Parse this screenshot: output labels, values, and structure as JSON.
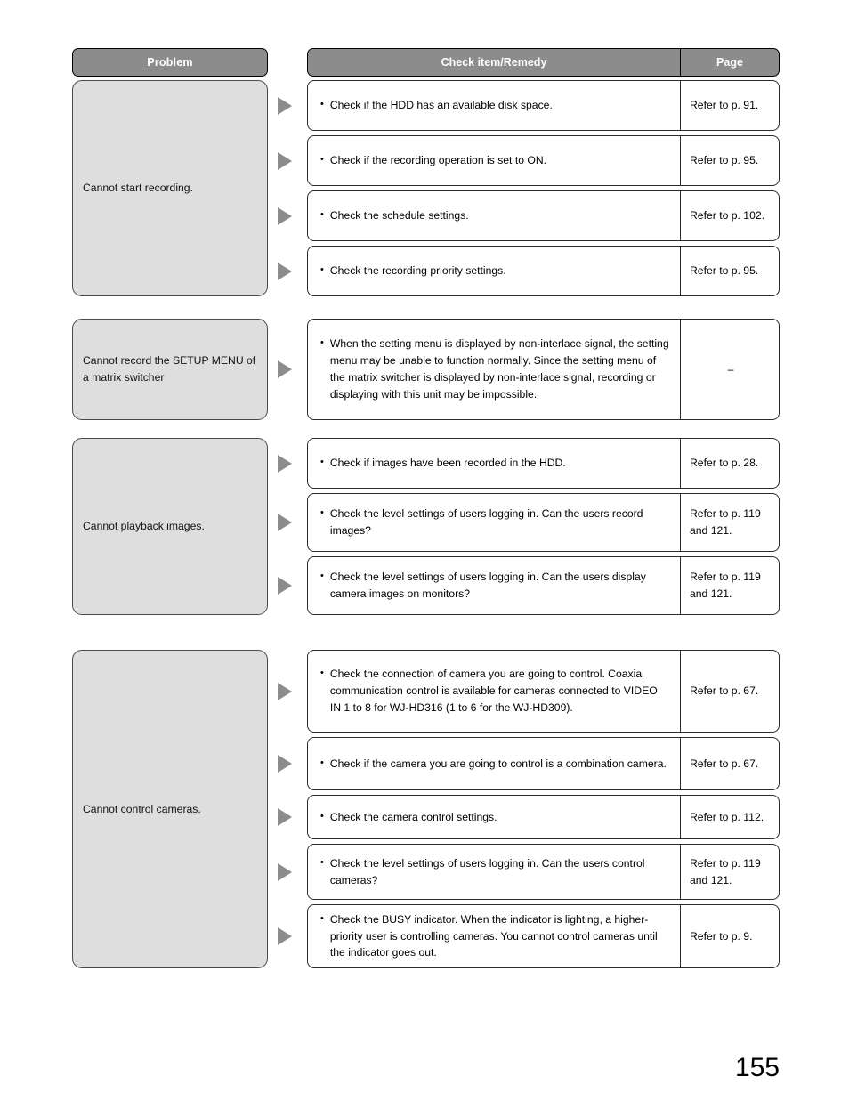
{
  "header": {
    "problem": "Problem",
    "check_item_remedy": "Check item/Remedy",
    "page": "Page"
  },
  "page_number": "155",
  "bullet_glyph": "•",
  "arrow_icon": "triangle-right-icon",
  "colors": {
    "header_fill": "#8c8c8c",
    "header_text": "#ffffff",
    "problem_fill": "#dedede",
    "arrow_fill": "#8c8c8c",
    "border": "#2b2b2b"
  },
  "sections": [
    {
      "problem": "Cannot start recording.",
      "rows": [
        {
          "check": "Check if the HDD has an available disk space.",
          "page": "Refer to p. 91."
        },
        {
          "check": "Check if the recording operation is set to ON.",
          "page": "Refer to p. 95."
        },
        {
          "check": "Check the schedule settings.",
          "page": "Refer to p. 102."
        },
        {
          "check": "Check the recording priority settings.",
          "page": "Refer to p. 95."
        }
      ]
    },
    {
      "problem": "Cannot record the SETUP MENU of a matrix switcher",
      "rows": [
        {
          "check": "When the setting menu is displayed by non-interlace signal, the setting menu may be unable to function normally. Since the setting menu of the matrix switcher is displayed by non-interlace signal, recording or displaying with this unit may be impossible.",
          "page": "–"
        }
      ]
    },
    {
      "problem": "Cannot playback images.",
      "rows": [
        {
          "check": "Check if images have been recorded in the HDD.",
          "page": "Refer to p. 28."
        },
        {
          "check": "Check the level settings of users logging in. Can the users record images?",
          "page": "Refer to p. 119 and 121."
        },
        {
          "check": "Check the level settings of users logging in. Can the users display camera images on monitors?",
          "page": "Refer to p. 119 and 121."
        }
      ]
    },
    {
      "problem": "Cannot control cameras.",
      "rows": [
        {
          "check": "Check the connection of camera you are going to control. Coaxial communication control is available for cameras connected to VIDEO IN 1 to 8 for WJ-HD316 (1 to 6 for the WJ-HD309).",
          "page": "Refer to p. 67."
        },
        {
          "check": "Check if the camera you are going to control is a combination camera.",
          "page": "Refer to p. 67."
        },
        {
          "check": "Check the camera control settings.",
          "page": "Refer to p. 112."
        },
        {
          "check": "Check the level settings of users logging in. Can the users control cameras?",
          "page": "Refer to p. 119 and 121."
        },
        {
          "check": "Check the BUSY indicator. When the indicator is lighting, a higher-priority user is controlling cameras. You cannot control cameras until the indicator goes out.",
          "page": "Refer to p. 9."
        }
      ]
    }
  ]
}
